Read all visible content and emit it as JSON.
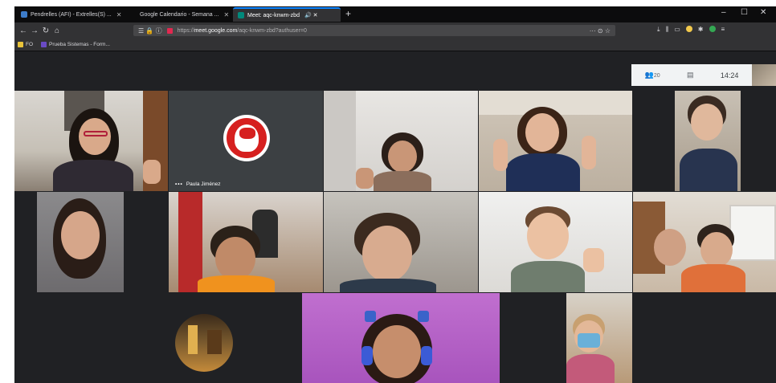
{
  "browser": {
    "tabs": [
      {
        "title": "Pendrelles (AFI) - Extrelles(S) ...",
        "fav_color": "#3d7cc9",
        "close": "✕"
      },
      {
        "title": "Google Calendario - Semana ...",
        "fav_color": "#4285f4",
        "close": "✕"
      },
      {
        "title": "Meet: aqc-knwm-zbd",
        "fav_color": "#00897b",
        "close": "✕",
        "audio": "🔊 ✕"
      }
    ],
    "new_tab": "+",
    "window_controls": {
      "min": "–",
      "max": "☐",
      "close": "✕"
    },
    "nav": {
      "back": "←",
      "forward": "→",
      "reload": "↻",
      "home": "⌂"
    },
    "url": {
      "prefix": "https://",
      "host": "meet.google.com",
      "path": "/aqc-knwm-zbd?authuser=0"
    },
    "url_left_icons": "☰ 🔒 ⓘ",
    "url_right_icons": "··· ⊙ ☆",
    "bookmarks": [
      {
        "label": "FO",
        "color": "#e8c33a"
      },
      {
        "label": "Prueba Sistemas - Form...",
        "color": "#6a4bc4"
      }
    ]
  },
  "meet": {
    "top_info": {
      "people_icon": "👥",
      "people_count": "20",
      "chat_icon": "▤",
      "time": "14:24"
    },
    "participants": [
      {
        "name": "Paula Jiménez",
        "name_dots": "•••"
      }
    ]
  }
}
